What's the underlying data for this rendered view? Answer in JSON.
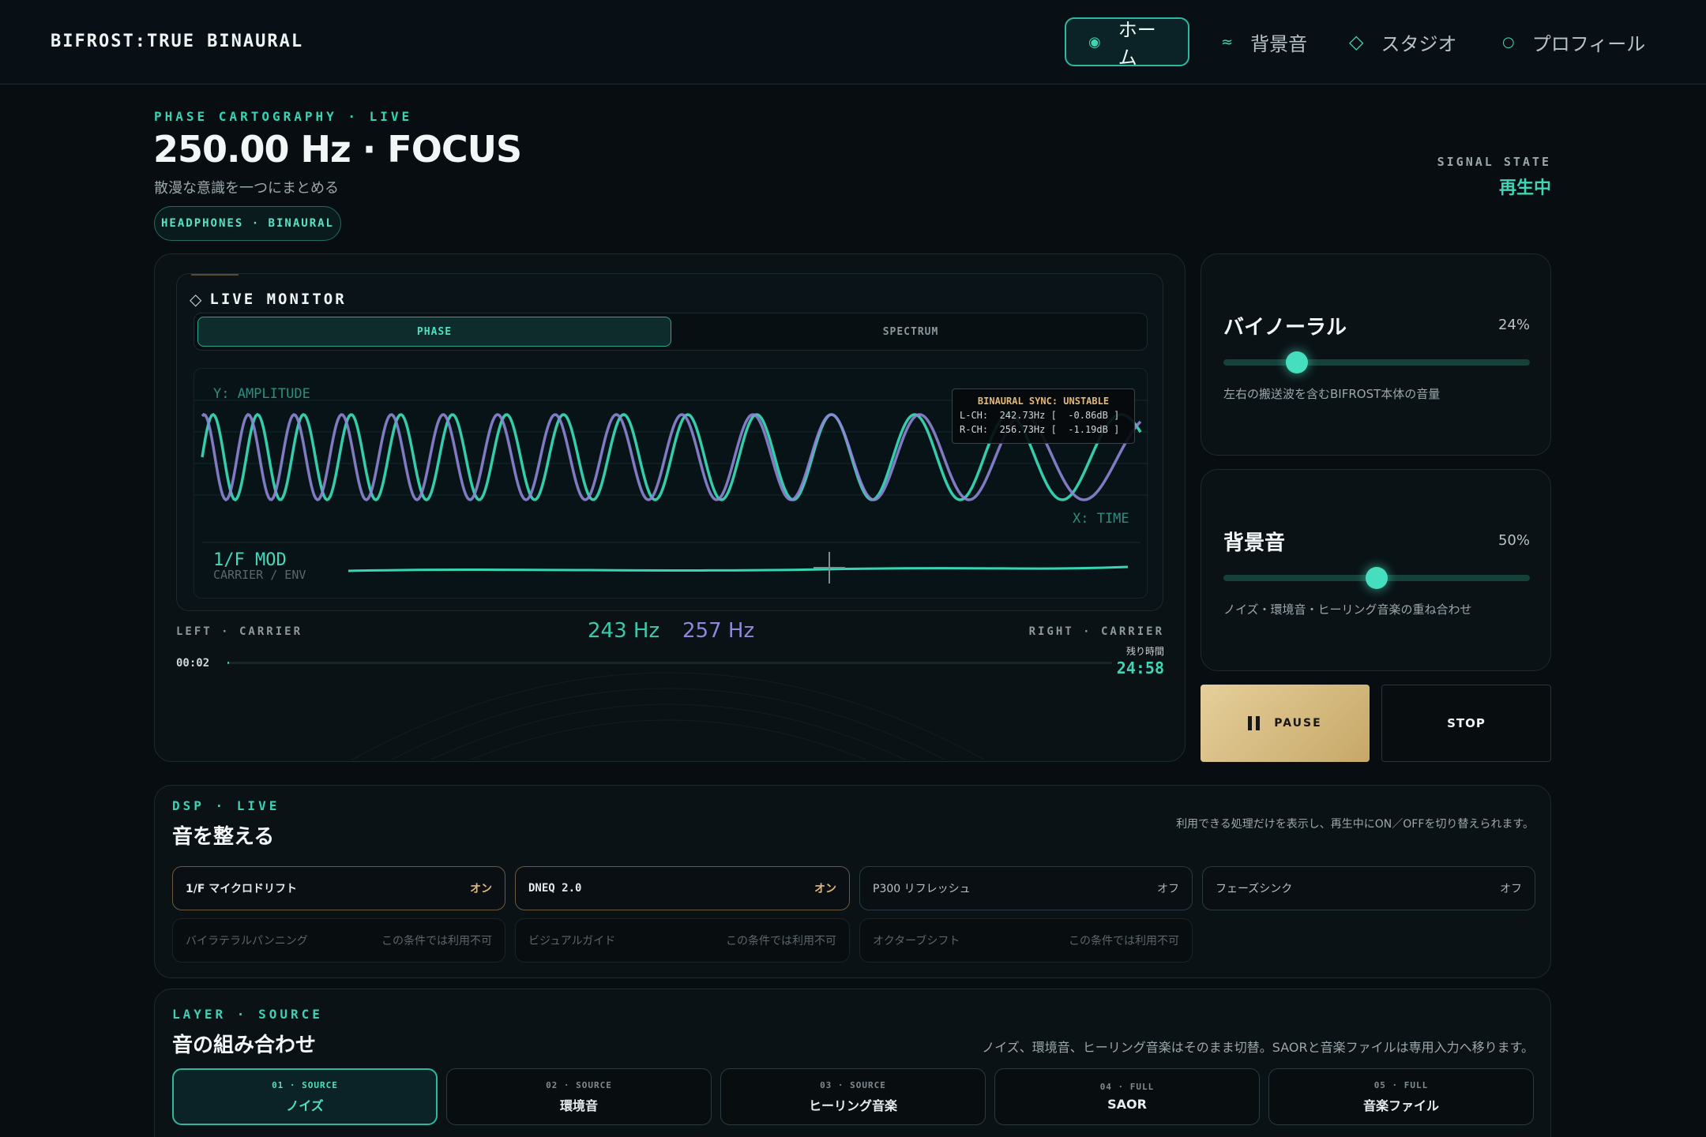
{
  "app": {
    "brand": "BIFROST:TRUE BINAURAL"
  },
  "nav": [
    {
      "icon": "◉",
      "label": "ホーム",
      "active": true
    },
    {
      "icon": "≈",
      "label": "背景音"
    },
    {
      "icon": "◇",
      "label": "スタジオ"
    },
    {
      "icon": "○",
      "label": "プロフィール"
    }
  ],
  "header": {
    "eyebrow": "PHASE CARTOGRAPHY · LIVE",
    "title": "250.00 Hz · FOCUS",
    "subtitle": "散漫な意識を一つにまとめる",
    "pill": "HEADPHONES · BINAURAL",
    "state_label": "SIGNAL STATE",
    "state_value": "再生中"
  },
  "monitor": {
    "title": "LIVE MONITOR",
    "tabs": [
      "PHASE",
      "SPECTRUM"
    ],
    "y_label": "Y: AMPLITUDE",
    "x_label": "X: TIME",
    "sync": {
      "status": "BINAURAL SYNC: UNSTABLE",
      "l_ch": "L-CH:  242.73Hz [  -0.86dB ]",
      "r_ch": "R-CH:  256.73Hz [  -1.19dB ]"
    },
    "mod_label": "1/F MOD",
    "mod_sub": "CARRIER / ENV",
    "left_label": "LEFT · CARRIER",
    "right_label": "RIGHT · CARRIER",
    "left_hz": "243 Hz",
    "right_hz": "257 Hz",
    "elapsed": "00:02",
    "remaining_label": "残り時間",
    "remaining": "24:58",
    "progress": 0.0013
  },
  "binaural": {
    "title": "バイノーラル",
    "percent": "24%",
    "value": 0.24,
    "desc": "左右の搬送波を含むBIFROST本体の音量"
  },
  "background": {
    "title": "背景音",
    "percent": "50%",
    "value": 0.5,
    "desc": "ノイズ・環境音・ヒーリング音楽の重ね合わせ"
  },
  "controls": {
    "pause": "PAUSE",
    "stop": "STOP"
  },
  "dsp": {
    "eyebrow": "DSP · LIVE",
    "title": "音を整える",
    "note": "利用できる処理だけを表示し、再生中にON／OFFを切り替えられます。",
    "items": [
      {
        "name": "1/F マイクロドリフト",
        "state": "オン"
      },
      {
        "name": "DNEQ 2.0",
        "state": "オン"
      },
      {
        "name": "P300 リフレッシュ",
        "state": "オフ"
      },
      {
        "name": "フェーズシンク",
        "state": "オフ"
      },
      {
        "name": "バイラテラルパンニング",
        "state": "この条件では利用不可"
      },
      {
        "name": "ビジュアルガイド",
        "state": "この条件では利用不可"
      },
      {
        "name": "オクターブシフト",
        "state": "この条件では利用不可"
      }
    ]
  },
  "layer": {
    "eyebrow": "LAYER · SOURCE",
    "title": "音の組み合わせ",
    "note": "ノイズ、環境音、ヒーリング音楽はそのまま切替。SAORと音楽ファイルは専用入力へ移ります。",
    "sources": [
      {
        "code": "01 · SOURCE",
        "label": "ノイズ"
      },
      {
        "code": "02 · SOURCE",
        "label": "環境音"
      },
      {
        "code": "03 · SOURCE",
        "label": "ヒーリング音楽"
      },
      {
        "code": "04 · FULL",
        "label": "SAOR"
      },
      {
        "code": "05 · FULL",
        "label": "音楽ファイル"
      }
    ]
  },
  "colors": {
    "accent": "#3fd6b6",
    "wave_left": "#37d6b3",
    "wave_right": "#8e86d6",
    "gold": "#e2b877"
  }
}
